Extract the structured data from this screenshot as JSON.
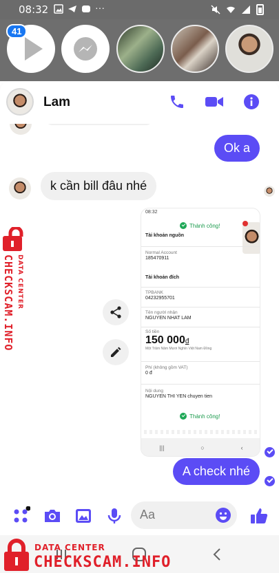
{
  "status_bar": {
    "time": "08:32"
  },
  "chat_heads": {
    "badge_count": "41"
  },
  "header": {
    "contact_name": "Lam"
  },
  "messages": [
    {
      "direction": "outgoing",
      "text": "Ok a"
    },
    {
      "direction": "incoming",
      "text": "k cần bill đâu nhé"
    },
    {
      "direction": "outgoing",
      "text": "A check nhé"
    }
  ],
  "shared_screenshot": {
    "time": "08:32",
    "success_top": "Thành công!",
    "source_account_heading": "Tài khoản nguồn",
    "source_account_type": "Normal Account",
    "source_account_number": "185470911",
    "dest_account_heading": "Tài khoản đích",
    "dest_bank": "TPBANK",
    "dest_account_number": "04232955701",
    "recipient_label": "Tên người nhận",
    "recipient_name": "NGUYEN NHAT LAM",
    "amount_label": "Số tiền",
    "amount": "150 000",
    "currency": "đ",
    "amount_words": "Một Trăm Năm Mươi Nghìn Việt Nam Đồng",
    "fee_label": "Phí (không gồm VAT)",
    "fee_value": "0 đ",
    "content_label": "Nội dung",
    "content_value": "NGUYEN THI YEN chuyen tien",
    "success_bottom": "Thành công!"
  },
  "composer": {
    "placeholder": "Aa"
  },
  "watermark": {
    "small": "DATA CENTER",
    "big": "CHECKSCAM.INFO"
  },
  "colors": {
    "accent": "#5b4cf5",
    "watermark": "#e0202a",
    "success": "#1fa857"
  }
}
